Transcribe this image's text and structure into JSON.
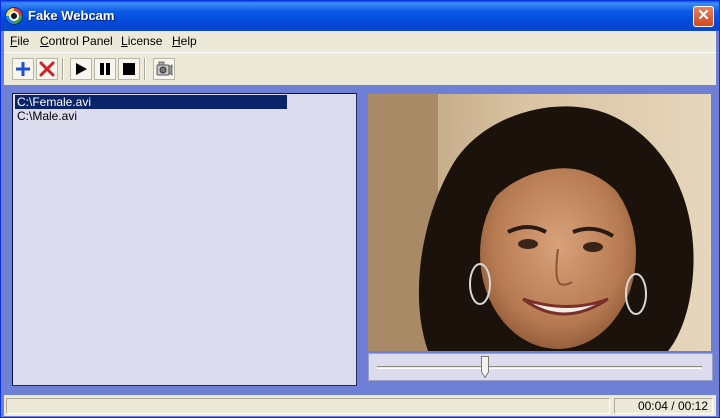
{
  "window": {
    "title": "Fake Webcam",
    "close_symbol": "✕"
  },
  "menu": [
    {
      "accel": "F",
      "rest": "ile"
    },
    {
      "accel": "C",
      "rest": "ontrol Panel"
    },
    {
      "accel": "L",
      "rest": "icense"
    },
    {
      "accel": "H",
      "rest": "elp"
    }
  ],
  "toolbar": {
    "buttons": [
      "add-icon",
      "remove-icon",
      "play-icon",
      "pause-icon",
      "stop-icon",
      "webcam-settings-icon"
    ]
  },
  "playlist": {
    "items": [
      {
        "label": "C:\\Female.avi",
        "selected": true
      },
      {
        "label": "C:\\Male.avi",
        "selected": false
      }
    ]
  },
  "player": {
    "progress": 0.333
  },
  "status": {
    "text": "",
    "time": "00:04 / 00:12"
  },
  "colors": {
    "titlebar": "#0a5ae5",
    "background": "#6f7fd6",
    "selection": "#0a246a"
  }
}
